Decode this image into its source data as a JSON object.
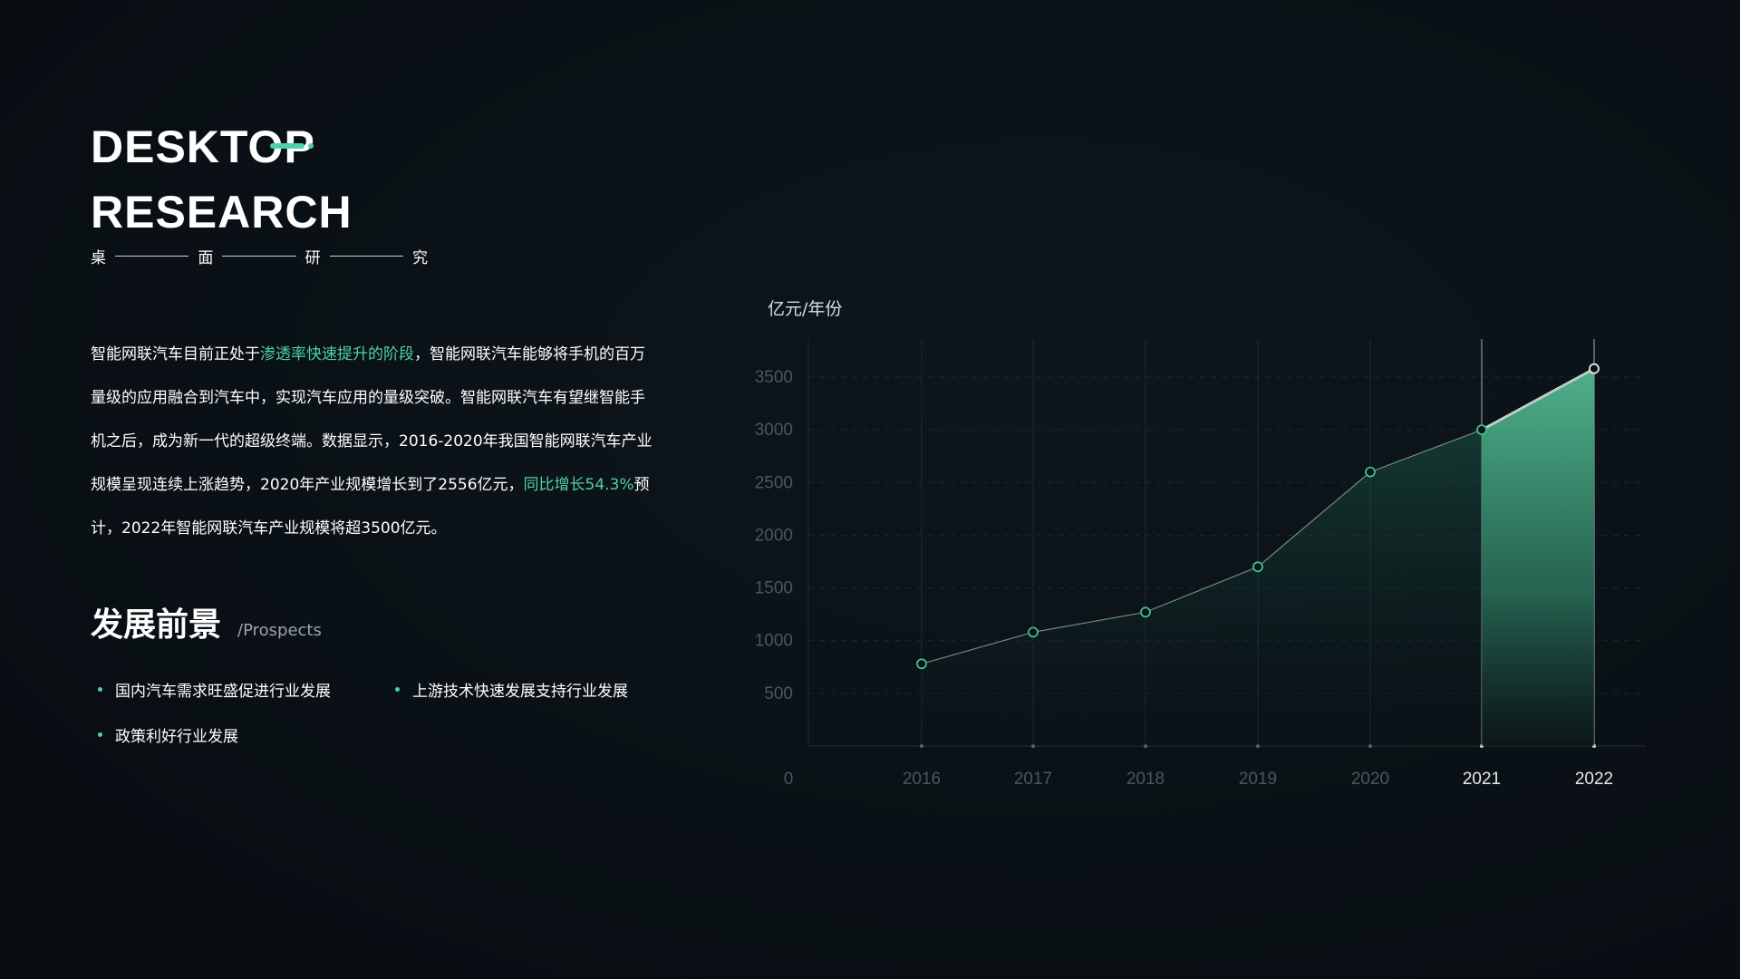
{
  "header": {
    "title_line1": "DESKTOP",
    "title_line2": "RESEARCH",
    "subtitle_chars": [
      "桌",
      "面",
      "研",
      "究"
    ]
  },
  "intro": {
    "p1": "智能网联汽车目前正处于",
    "hl1": "渗透率快速提升的阶段",
    "p2": "，智能网联汽车能够将手机的百万量级的应用融合到汽车中，实现汽车应用的量级突破。智能网联汽车有望继智能手机之后，成为新一代的超级终端。数据显示，2016-2020年我国智能网联汽车产业规模呈现连续上涨趋势，2020年产业规模增长到了2556亿元，",
    "hl2": "同比增长54.3%",
    "p3": "预计，2022年智能网联汽车产业规模将超3500亿元。"
  },
  "prospects": {
    "title": "发展前景",
    "title_en": "/Prospects",
    "items": [
      "国内汽车需求旺盛促进行业发展",
      "上游技术快速发展支持行业发展",
      "政策利好行业发展"
    ]
  },
  "colors": {
    "accent": "#4fd1a5",
    "background": "#0a1116",
    "text": "#ffffff",
    "muted": "#5d676d"
  },
  "chart_data": {
    "type": "area",
    "ylabel": "亿元/年份",
    "categories": [
      "2016",
      "2017",
      "2018",
      "2019",
      "2020",
      "2021",
      "2022"
    ],
    "series": [
      {
        "values": [
          780,
          1080,
          1270,
          1700,
          2600,
          3000,
          3580
        ]
      }
    ],
    "ylim": [
      0,
      3500
    ],
    "yticks": [
      0,
      500,
      1000,
      1500,
      2000,
      2500,
      3000,
      3500
    ],
    "highlight_categories": [
      "2021",
      "2022"
    ],
    "grid": true
  }
}
